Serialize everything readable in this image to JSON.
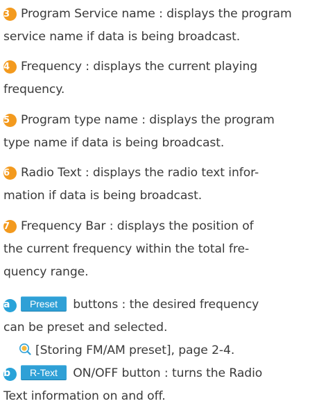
{
  "items": [
    {
      "marker": "3",
      "lines": [
        "Program Service name : displays the program",
        "service name if data is being broadcast."
      ]
    },
    {
      "marker": "4",
      "lines": [
        "Frequency : displays the current playing",
        "frequency."
      ]
    },
    {
      "marker": "5",
      "lines": [
        "Program type name : displays the program",
        "type name if data is being broadcast."
      ]
    },
    {
      "marker": "6",
      "lines": [
        "Radio Text : displays the radio text infor-",
        "mation if data is being broadcast."
      ]
    },
    {
      "marker": "7",
      "lines": [
        "Frequency Bar : displays the position of",
        "the current frequency within the total fre-",
        "quency range."
      ]
    }
  ],
  "buttons_section": {
    "a": {
      "marker": "a",
      "button_label": "Preset",
      "line1_rest": "buttons : the desired frequency",
      "line2": "can be preset and selected.",
      "reference": "[Storing FM/AM preset], page 2-4.",
      "reference_icon": "magnifier-reference-icon"
    },
    "b": {
      "marker": "b",
      "button_label": "R-Text",
      "line1_rest": "ON/OFF button : turns the Radio",
      "line2": "Text information on and off."
    }
  },
  "colors": {
    "number_badge": "#f39a1e",
    "letter_badge": "#29a3d9",
    "button_bg": "#2fa0d6",
    "text": "#3a3a3a"
  }
}
